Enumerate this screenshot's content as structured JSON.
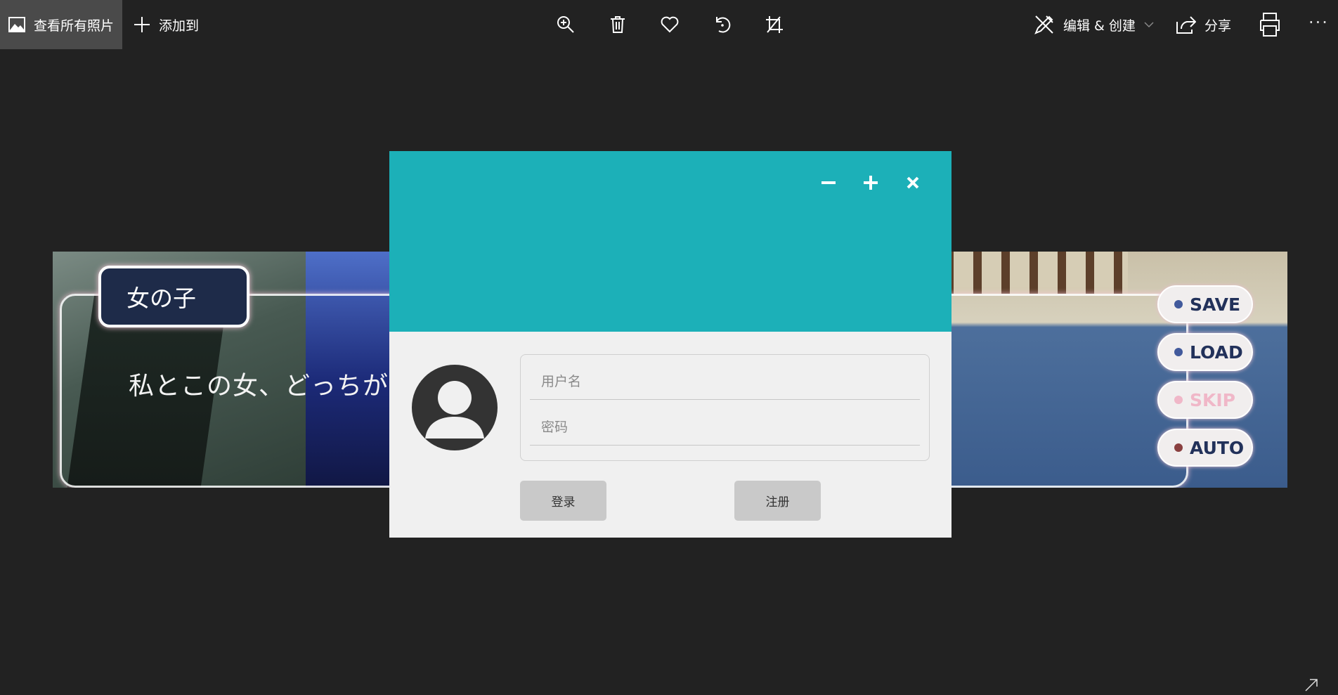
{
  "toolbar": {
    "view_all_label": "查看所有照片",
    "add_to_label": "添加到",
    "edit_create_label": "编辑 & 创建",
    "share_label": "分享",
    "more_label": "···"
  },
  "photo": {
    "name_tag": "女の子",
    "dialogue": "私とこの女、どっちが",
    "menu_buttons": [
      "SAVE",
      "LOAD",
      "SKIP",
      "AUTO"
    ]
  },
  "login": {
    "username_placeholder": "用户名",
    "password_placeholder": "密码",
    "login_button": "登录",
    "register_button": "注册",
    "header_color": "#1cb0b8"
  }
}
